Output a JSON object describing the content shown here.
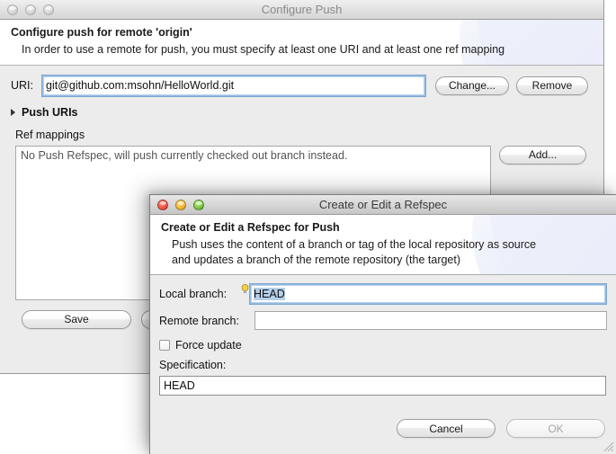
{
  "outer_window": {
    "title": "Configure Push",
    "traffic_lights": [
      "close",
      "minimize",
      "zoom"
    ],
    "banner": {
      "title": "Configure push for remote 'origin'",
      "description": "In order to use a remote for push, you must specify at least one URI and at least one ref mapping"
    },
    "uri_row": {
      "label": "URI:",
      "value": "git@github.com:msohn/HelloWorld.git",
      "placeholder": "",
      "change_button": "Change...",
      "remove_button": "Remove"
    },
    "push_uris": {
      "label": "Push URIs",
      "expanded": false
    },
    "ref_mappings": {
      "label": "Ref mappings",
      "empty_text": "No Push Refspec, will push currently checked out branch instead.",
      "add_button": "Add..."
    },
    "footer": {
      "save_button": "Save"
    }
  },
  "inner_dialog": {
    "title": "Create or Edit a Refspec",
    "traffic_lights": [
      "close",
      "minimize",
      "zoom"
    ],
    "banner": {
      "title": "Create or Edit a Refspec for Push",
      "description": "Push uses the content of a branch or tag of the local repository as source and updates a branch of the remote repository (the target)"
    },
    "local_branch": {
      "label": "Local branch:",
      "value": "HEAD",
      "placeholder": "",
      "selected": true,
      "decoration": "lightbulb-content-assist"
    },
    "remote_branch": {
      "label": "Remote branch:",
      "value": "",
      "placeholder": ""
    },
    "force_update": {
      "label": "Force update",
      "checked": false
    },
    "specification": {
      "label": "Specification:",
      "value": "HEAD",
      "placeholder": ""
    },
    "footer": {
      "cancel_button": "Cancel",
      "ok_button": "OK",
      "ok_enabled": false
    }
  },
  "colors": {
    "window_bg": "#ececec",
    "banner_bg": "#ffffff",
    "accent_focus": "#7da6d0",
    "selection": "#b5cfe9",
    "light_red": "#e8503f",
    "light_yellow": "#f0b12c",
    "light_green": "#74c13c"
  }
}
